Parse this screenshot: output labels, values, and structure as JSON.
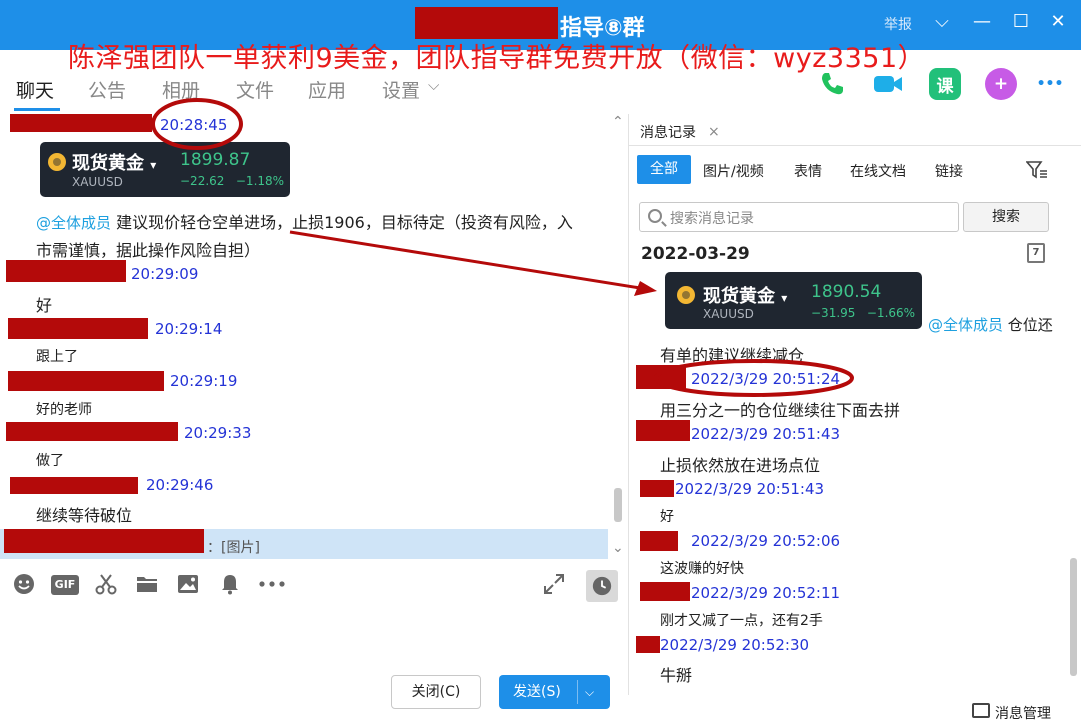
{
  "window": {
    "title": "指导⑧群",
    "report": "举报",
    "chevron": "⌵",
    "minimize": "—",
    "maximize": "☐",
    "close": "✕"
  },
  "promo_text": "陈泽强团队一单获利9美金，团队指导群免费开放（微信：wyz3351）",
  "nav": {
    "tabs": [
      "聊天",
      "公告",
      "相册",
      "文件",
      "应用",
      "设置"
    ],
    "settings_arrow": "⌵",
    "icons": [
      "phone-icon",
      "video-call-icon",
      "class-icon",
      "add-icon",
      "more-icon"
    ],
    "class_label": "课",
    "add_label": "+",
    "more_label": "•••"
  },
  "chat": {
    "first_ts": "20:28:45",
    "card": {
      "name": "现货黄金",
      "arrow": "▾",
      "symbol": "XAUUSD",
      "price": "1899.87",
      "change": "−22.62",
      "percent": "−1.18%"
    },
    "mention": "@全体成员",
    "advice_line1": "建议现价轻仓空单进场，止损1906，目标待定（投资有风险，入",
    "advice_line2": "市需谨慎，据此操作风险自担）",
    "messages": [
      {
        "ts": "20:29:09",
        "text": "好"
      },
      {
        "ts": "20:29:14",
        "text": "跟上了"
      },
      {
        "ts": "20:29:19",
        "text": "好的老师"
      },
      {
        "ts": "20:29:33",
        "text": "做了"
      },
      {
        "ts": "20:29:46",
        "text": "继续等待破位"
      }
    ],
    "last_preview": "：[图片]",
    "collapse_top": "⌃",
    "collapse_bottom": "⌄"
  },
  "toolbar": {
    "icons": [
      "emoji-icon",
      "gif-icon",
      "scissors-icon",
      "folder-icon",
      "image-icon",
      "bell-icon",
      "more-icon"
    ],
    "gif": "GIF",
    "close_btn": "关闭(C)",
    "send_btn": "发送(S)",
    "send_arrow": "⌵"
  },
  "history": {
    "tab": "消息记录",
    "tab_close": "×",
    "filters": [
      "全部",
      "图片/视频",
      "表情",
      "在线文档",
      "链接"
    ],
    "search_placeholder": "搜索消息记录",
    "search_btn": "搜索",
    "date": "2022-03-29",
    "cal_day": "7",
    "card": {
      "name": "现货黄金",
      "arrow": "▾",
      "symbol": "XAUUSD",
      "price": "1890.54",
      "change": "−31.95",
      "percent": "−1.66%"
    },
    "mention": "@全体成员",
    "mention_text": "仓位还",
    "line_cut": "有单的建议继续减仓",
    "entries": [
      {
        "ts": "2022/3/29 20:51:24",
        "text": "用三分之一的仓位继续往下面去拼"
      },
      {
        "ts": "2022/3/29 20:51:43",
        "text": "止损依然放在进场点位"
      },
      {
        "ts": "2022/3/29 20:51:43",
        "text": "好"
      },
      {
        "ts": "2022/3/29 20:52:06",
        "text": "这波赚的好快"
      },
      {
        "ts": "2022/3/29 20:52:11",
        "text": "刚才又减了一点，还有2手"
      },
      {
        "ts": "2022/3/29 20:52:30",
        "text": "牛掰"
      }
    ],
    "manage": "消息管理"
  },
  "colors": {
    "accent": "#1e8fe8",
    "redaction": "#b40a0a",
    "timestamp": "#2433d6",
    "mention": "#1ea0df",
    "promo": "#e81b1b",
    "gain_green": "#3ec48b"
  }
}
